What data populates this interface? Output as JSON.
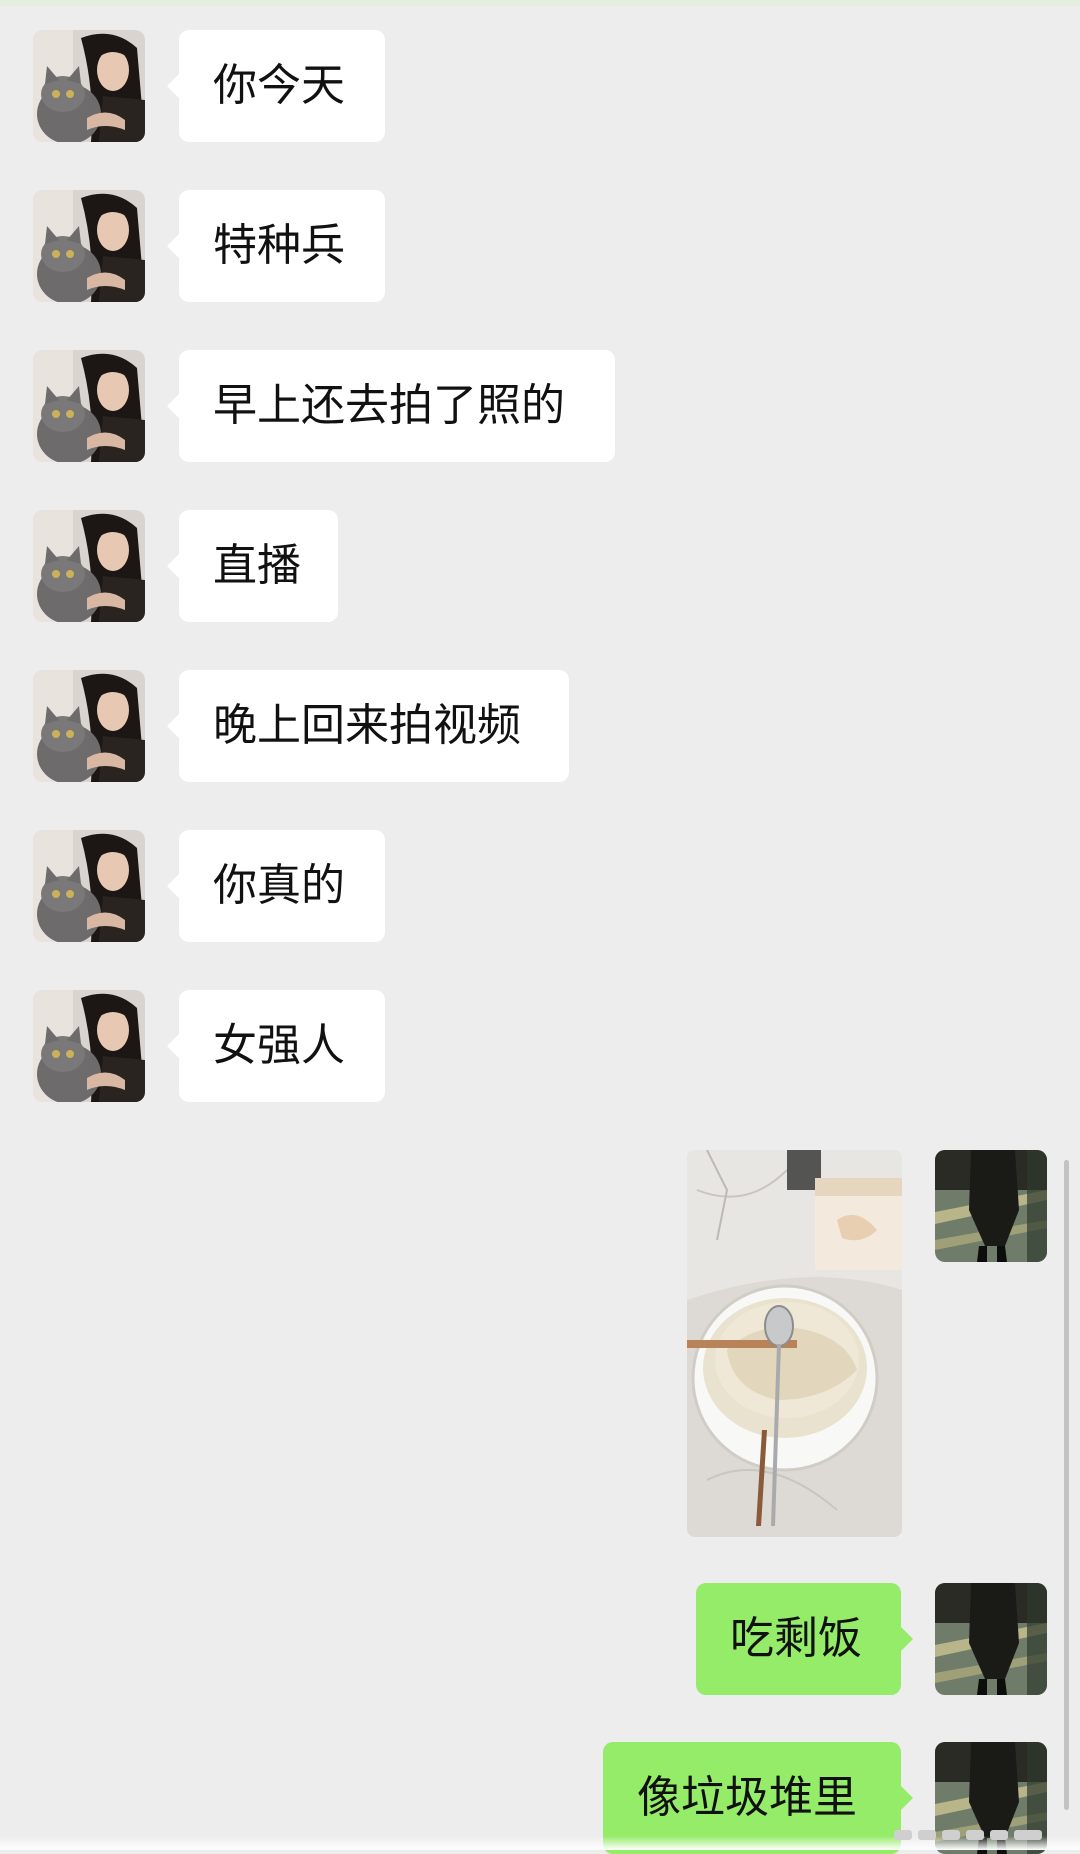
{
  "chat": {
    "contact_avatar_icon": "woman-with-cat-avatar",
    "self_avatar_icon": "walking-person-avatar",
    "colors": {
      "background": "#ededed",
      "incoming_bubble": "#ffffff",
      "outgoing_bubble": "#95ec69",
      "text": "#111111"
    },
    "messages": [
      {
        "sender": "contact",
        "type": "text",
        "text": "你今天"
      },
      {
        "sender": "contact",
        "type": "text",
        "text": "特种兵"
      },
      {
        "sender": "contact",
        "type": "text",
        "text": "早上还去拍了照的"
      },
      {
        "sender": "contact",
        "type": "text",
        "text": "直播"
      },
      {
        "sender": "contact",
        "type": "text",
        "text": "晚上回来拍视频"
      },
      {
        "sender": "contact",
        "type": "text",
        "text": "你真的"
      },
      {
        "sender": "contact",
        "type": "text",
        "text": "女强人"
      },
      {
        "sender": "self",
        "type": "image",
        "image_icon": "leftover-rice-bowl-photo"
      },
      {
        "sender": "self",
        "type": "text",
        "text": "吃剩饭"
      },
      {
        "sender": "self",
        "type": "text",
        "text": "像垃圾堆里"
      }
    ]
  }
}
